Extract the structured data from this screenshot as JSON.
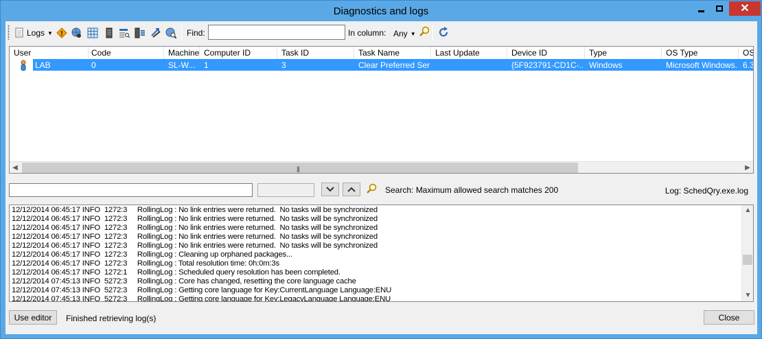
{
  "window": {
    "title": "Diagnostics and logs",
    "close_glyph": "✕"
  },
  "toolbar": {
    "logs_label": "Logs",
    "find_label": "Find:",
    "find_value": "",
    "in_column_label": "In column:",
    "in_column_value": "Any",
    "icons": [
      "logs-icon",
      "warning-icon",
      "globe-icon",
      "grid-icon",
      "server-icon",
      "search-list-icon",
      "list-icon",
      "arrows-icon",
      "globe-search-icon",
      "search-icon",
      "refresh-icon"
    ]
  },
  "grid": {
    "columns": [
      "User",
      "Code",
      "Machine",
      "Computer ID",
      "Task ID",
      "Task Name",
      "Last Update",
      "Device ID",
      "Type",
      "OS Type",
      "OS"
    ],
    "rows": [
      {
        "user": "LAB",
        "code": "0",
        "machine": "SL-W...",
        "computer_id": "1",
        "task_id": "3",
        "task_name": "Clear Preferred Ser...",
        "last_update": "",
        "device_id": "{5F923791-CD1C-...",
        "type": "Windows",
        "os_type": "Microsoft Windows...",
        "os": "6.3"
      }
    ],
    "selected_row": 0
  },
  "search": {
    "value": "",
    "count": "",
    "status": "Search: Maximum allowed search matches 200",
    "log_name": "Log: SchedQry.exe.log"
  },
  "log": {
    "lines": [
      "12/12/2014 06:45:17 INFO  1272:3     RollingLog : No link entries were returned.  No tasks will be synchronized",
      "12/12/2014 06:45:17 INFO  1272:3     RollingLog : No link entries were returned.  No tasks will be synchronized",
      "12/12/2014 06:45:17 INFO  1272:3     RollingLog : No link entries were returned.  No tasks will be synchronized",
      "12/12/2014 06:45:17 INFO  1272:3     RollingLog : No link entries were returned.  No tasks will be synchronized",
      "12/12/2014 06:45:17 INFO  1272:3     RollingLog : No link entries were returned.  No tasks will be synchronized",
      "12/12/2014 06:45:17 INFO  1272:3     RollingLog : Cleaning up orphaned packages...",
      "12/12/2014 06:45:17 INFO  1272:3     RollingLog : Total resolution time: 0h:0m:3s",
      "12/12/2014 06:45:17 INFO  1272:1     RollingLog : Scheduled query resolution has been completed.",
      "12/12/2014 07:45:13 INFO  5272:3     RollingLog : Core has changed, resetting the core language cache",
      "12/12/2014 07:45:13 INFO  5272:3     RollingLog : Getting core language for Key:CurrentLanguage Language:ENU",
      "12/12/2014 07:45:13 INFO  5272:3     RollingLog : Getting core language for Key:LegacyLanguage Language:ENU"
    ]
  },
  "footer": {
    "use_editor_label": "Use editor",
    "status": "Finished retrieving log(s)",
    "close_label": "Close"
  },
  "colors": {
    "title_bar": "#5aa8e6",
    "selection": "#3399ff",
    "close": "#c7372f"
  }
}
